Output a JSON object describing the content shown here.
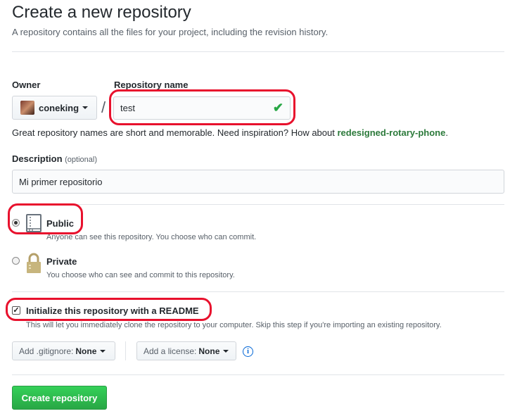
{
  "header": {
    "title": "Create a new repository",
    "subtitle": "A repository contains all the files for your project, including the revision history."
  },
  "owner": {
    "label": "Owner",
    "value": "coneking"
  },
  "repo_name": {
    "label": "Repository name",
    "value": "test",
    "separator": "/"
  },
  "name_hint": {
    "text": "Great repository names are short and memorable. Need inspiration? How about ",
    "suggestion": "redesigned-rotary-phone",
    "suffix": "."
  },
  "description": {
    "label": "Description",
    "optional": "(optional)",
    "value": "Mi primer repositorio"
  },
  "visibility": {
    "public": {
      "label": "Public",
      "desc": "Anyone can see this repository. You choose who can commit."
    },
    "private": {
      "label": "Private",
      "desc": "You choose who can see and commit to this repository."
    },
    "selected": "public"
  },
  "readme": {
    "label": "Initialize this repository with a README",
    "desc": "This will let you immediately clone the repository to your computer. Skip this step if you're importing an existing repository.",
    "checked": true
  },
  "gitignore": {
    "label": "Add .gitignore:",
    "value": "None"
  },
  "license": {
    "label": "Add a license:",
    "value": "None"
  },
  "info_icon": "i",
  "submit": {
    "label": "Create repository"
  },
  "colors": {
    "accent_green": "#28a745",
    "highlight_red": "#e8112d"
  }
}
